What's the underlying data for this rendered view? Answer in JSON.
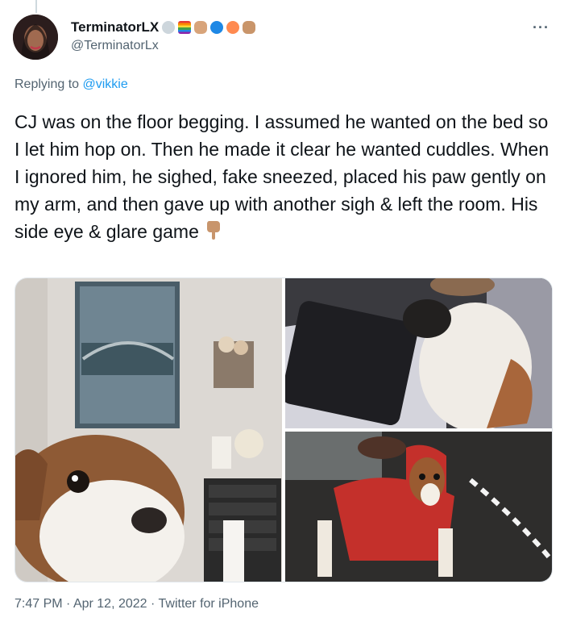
{
  "user": {
    "display_name": "TerminatorLX",
    "handle": "@TerminatorLx"
  },
  "reply": {
    "prefix": "Replying to",
    "handle": "@vikkie"
  },
  "tweet": {
    "text": "CJ was on the floor begging. I assumed he wanted on the bed so I let him hop on. Then he made it clear he wanted cuddles. When I ignored him, he sighed, fake sneezed, placed his paw gently on my arm, and then gave up with another sigh & left the room. His side eye & glare game"
  },
  "meta": {
    "time": "7:47 PM",
    "sep1": " · ",
    "date": "Apr 12, 2022",
    "sep2": " · ",
    "source": "Twitter for iPhone"
  },
  "icons": {
    "more": "more-icon",
    "hand": "backhand-index-pointing-down-icon"
  },
  "colors": {
    "link": "#1d9bf0",
    "secondary_text": "#536471"
  }
}
